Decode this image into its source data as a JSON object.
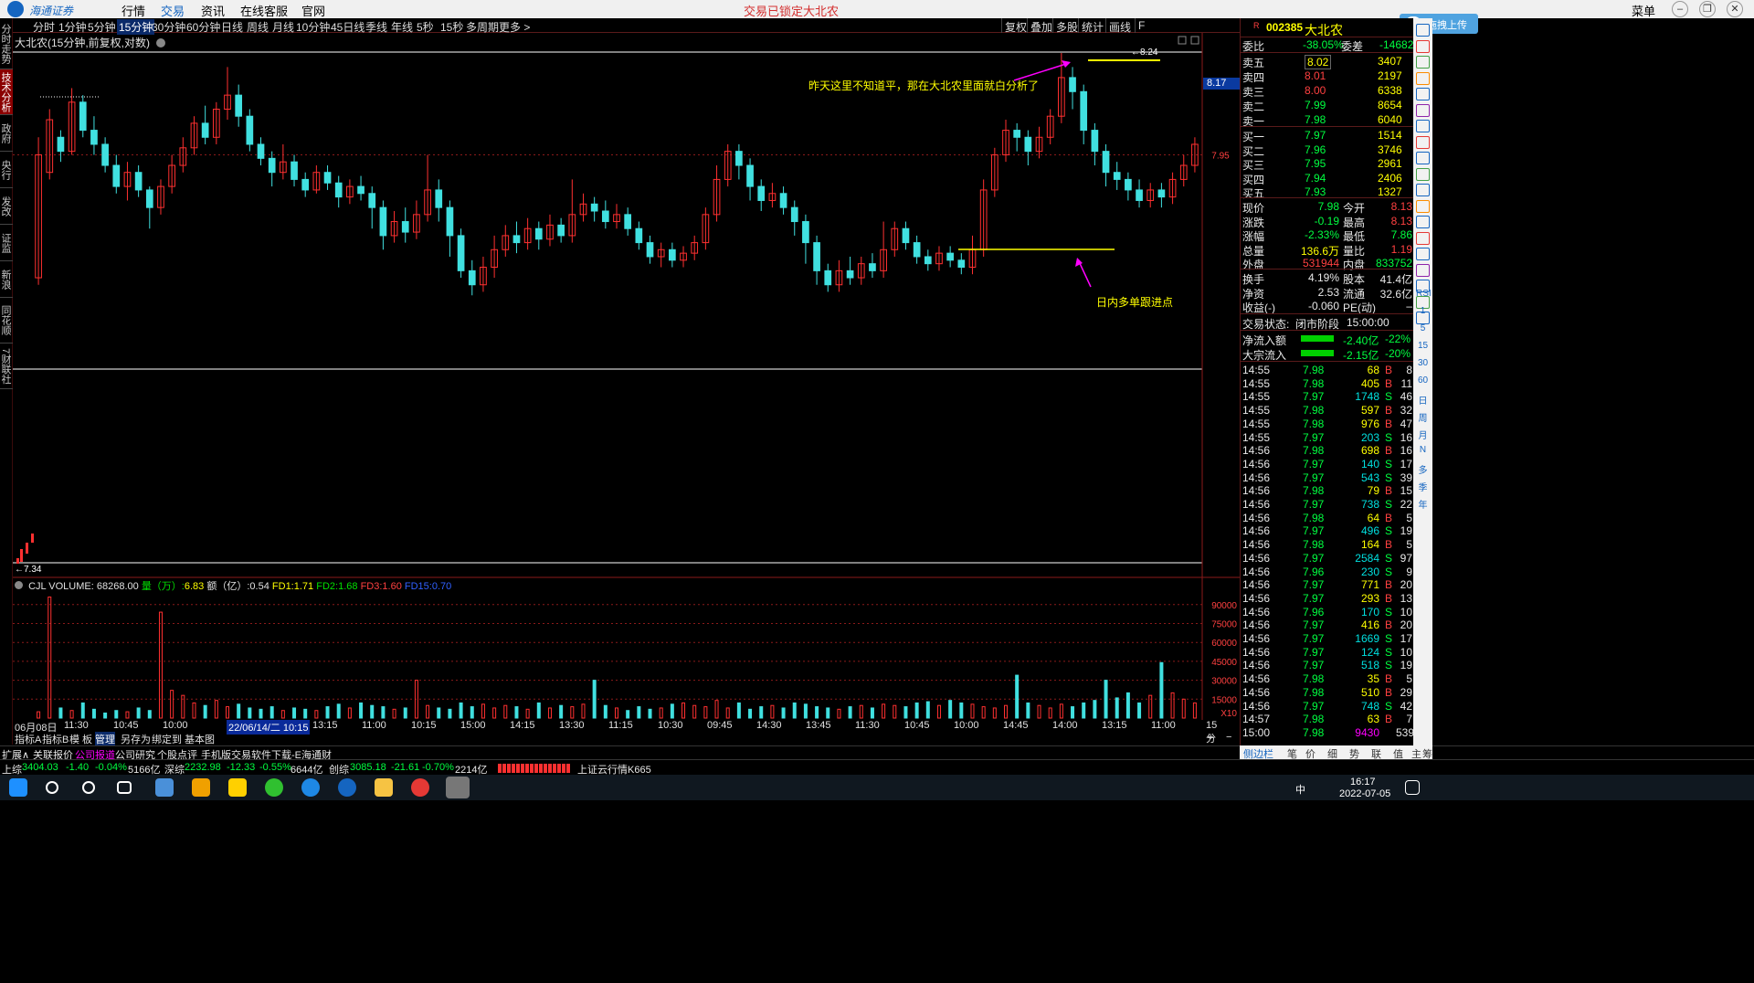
{
  "menu": {
    "logo_text": "海通证券",
    "logo_sub": "HAITONG",
    "items": [
      "行情",
      "交易",
      "资讯",
      "在线客服",
      "官网"
    ],
    "active_index": 1,
    "lock_status": "交易已锁定",
    "stock_tag": "大北农",
    "right_menu": "菜单"
  },
  "left_tabs": [
    "分时走势",
    "技术分析",
    "政府",
    "央行",
    "发改",
    "证监",
    "新浪",
    "同花顺",
    "7财联社"
  ],
  "left_tabs_active": 1,
  "periods": [
    "分时",
    "1分钟",
    "5分钟",
    "15分钟",
    "30分钟",
    "60分钟",
    "日线",
    "周线",
    "月线",
    "10分钟",
    "45日线",
    "季线",
    "年线",
    "5秒",
    "15秒",
    "多周期",
    "更多 >"
  ],
  "period_active": 3,
  "toolbar_right": [
    "复权",
    "叠加",
    "多股",
    "统计",
    "画线",
    "F"
  ],
  "cloud_button": "拖拽上传",
  "chart_title": "大北农(15分钟,前复权,对数)",
  "annotations": {
    "top": "昨天这里不知道平，那在大北农里面就白分析了",
    "mid": "日内多单跟进点"
  },
  "price_labels": {
    "high": "8.24",
    "low": "7.34",
    "axis_label": "7.95",
    "current_box": "8.17"
  },
  "volume_header": {
    "name": "CJL",
    "vol_label": "VOLUME:",
    "vol_value": "68268.00",
    "liang_label": "量（万）:",
    "liang_value": "6.83",
    "e_label": "额（亿）:",
    "e_value": "0.54",
    "fd1_label": "FD1:",
    "fd1_value": "1.71",
    "fd2_label": "FD2:",
    "fd2_value": "1.68",
    "fd3_label": "FD3:",
    "fd3_value": "1.60",
    "fd15_label": "FD15:",
    "fd15_value": "0.70"
  },
  "volume_axis": [
    "90000",
    "75000",
    "60000",
    "45000",
    "30000",
    "15000",
    "X10"
  ],
  "x_axis": [
    "06月08日",
    "11:30",
    "10:45",
    "10:00",
    "14",
    "22/06/14/二 10:15",
    "13:15",
    "11:00",
    "10:15",
    "15:00",
    "14:15",
    "13:30",
    "11:15",
    "10:30",
    "09:45",
    "14:30",
    "13:45",
    "11:30",
    "10:45",
    "10:00",
    "14:45",
    "14:00",
    "13:15",
    "11:00"
  ],
  "x_axis_right": "15分钟",
  "chart_tabs": [
    "指标A",
    "指标B",
    "模 板",
    "管理",
    "另存为",
    "绑定到",
    "基本图"
  ],
  "chart_tabs_active": 3,
  "chart_zoom": [
    "+",
    "−"
  ],
  "status_links": [
    "扩展∧",
    "关联报价",
    "公司报道",
    "公司研究",
    "个股点评",
    "手机版交易软件下载-E海通财"
  ],
  "ticker": {
    "sh_label": "上综",
    "sh_value": "3404.03",
    "sh_chg": "-1.40",
    "sh_pct": "-0.04%",
    "sh_amt": "5166亿",
    "sz_label": "深综",
    "sz_value": "2232.98",
    "sz_chg": "-12.33",
    "sz_pct": "-0.55%",
    "sz_amt": "6644亿",
    "cy_label": "创综",
    "cy_value": "3085.18",
    "cy_chg": "-21.61",
    "cy_pct": "-0.70%",
    "cy_amt": "2214亿",
    "cloud": "上证云行情K665"
  },
  "quote": {
    "code": "002385",
    "name": "大北农",
    "weibi_label": "委比",
    "weibi": "-38.05%",
    "weicha_label": "委差",
    "weicha": "-14682",
    "asks": [
      {
        "label": "卖五",
        "price": "8.02",
        "vol": "3407"
      },
      {
        "label": "卖四",
        "price": "8.01",
        "vol": "2197"
      },
      {
        "label": "卖三",
        "price": "8.00",
        "vol": "6338"
      },
      {
        "label": "卖二",
        "price": "7.99",
        "vol": "8654"
      },
      {
        "label": "卖一",
        "price": "7.98",
        "vol": "6040"
      }
    ],
    "bids": [
      {
        "label": "买一",
        "price": "7.97",
        "vol": "1514"
      },
      {
        "label": "买二",
        "price": "7.96",
        "vol": "3746"
      },
      {
        "label": "买三",
        "price": "7.95",
        "vol": "2961"
      },
      {
        "label": "买四",
        "price": "7.94",
        "vol": "2406"
      },
      {
        "label": "买五",
        "price": "7.93",
        "vol": "1327"
      }
    ],
    "stats": [
      {
        "l1": "现价",
        "v1": "7.98",
        "l2": "今开",
        "v2": "8.13",
        "c1": "green",
        "c2": "red"
      },
      {
        "l1": "涨跌",
        "v1": "-0.19",
        "l2": "最高",
        "v2": "8.13",
        "c1": "green",
        "c2": "red"
      },
      {
        "l1": "涨幅",
        "v1": "-2.33%",
        "l2": "最低",
        "v2": "7.86",
        "c1": "green",
        "c2": "green"
      },
      {
        "l1": "总量",
        "v1": "136.6万",
        "l2": "量比",
        "v2": "1.19",
        "c1": "yellow",
        "c2": "red"
      },
      {
        "l1": "外盘",
        "v1": "531944",
        "l2": "内盘",
        "v2": "833752",
        "c1": "red",
        "c2": "green"
      }
    ],
    "stats2": [
      {
        "l1": "换手",
        "v1": "4.19%",
        "l2": "股本",
        "v2": "41.4亿"
      },
      {
        "l1": "净资",
        "v1": "2.53",
        "l2": "流通",
        "v2": "32.6亿"
      },
      {
        "l1": "收益(-)",
        "v1": "-0.060",
        "l2": "PE(动)",
        "v2": "–"
      }
    ],
    "trade_state_label": "交易状态:",
    "trade_state": "闭市阶段",
    "trade_time": "15:00:00",
    "flows": [
      {
        "label": "净流入额",
        "value": "-2.40亿",
        "pct": "-22%"
      },
      {
        "label": "大宗流入",
        "value": "-2.15亿",
        "pct": "-20%"
      }
    ]
  },
  "ticks": [
    {
      "t": "14:55",
      "p": "7.98",
      "v": "68",
      "d": "B",
      "n": "8"
    },
    {
      "t": "14:55",
      "p": "7.98",
      "v": "405",
      "d": "B",
      "n": "11"
    },
    {
      "t": "14:55",
      "p": "7.97",
      "v": "1748",
      "d": "S",
      "n": "46"
    },
    {
      "t": "14:55",
      "p": "7.98",
      "v": "597",
      "d": "B",
      "n": "32"
    },
    {
      "t": "14:55",
      "p": "7.98",
      "v": "976",
      "d": "B",
      "n": "47"
    },
    {
      "t": "14:55",
      "p": "7.97",
      "v": "203",
      "d": "S",
      "n": "16"
    },
    {
      "t": "14:56",
      "p": "7.98",
      "v": "698",
      "d": "B",
      "n": "16"
    },
    {
      "t": "14:56",
      "p": "7.97",
      "v": "140",
      "d": "S",
      "n": "17"
    },
    {
      "t": "14:56",
      "p": "7.97",
      "v": "543",
      "d": "S",
      "n": "39"
    },
    {
      "t": "14:56",
      "p": "7.98",
      "v": "79",
      "d": "B",
      "n": "15"
    },
    {
      "t": "14:56",
      "p": "7.97",
      "v": "738",
      "d": "S",
      "n": "22"
    },
    {
      "t": "14:56",
      "p": "7.98",
      "v": "64",
      "d": "B",
      "n": "5"
    },
    {
      "t": "14:56",
      "p": "7.97",
      "v": "496",
      "d": "S",
      "n": "19"
    },
    {
      "t": "14:56",
      "p": "7.98",
      "v": "164",
      "d": "B",
      "n": "5"
    },
    {
      "t": "14:56",
      "p": "7.97",
      "v": "2584",
      "d": "S",
      "n": "97"
    },
    {
      "t": "14:56",
      "p": "7.96",
      "v": "230",
      "d": "S",
      "n": "9"
    },
    {
      "t": "14:56",
      "p": "7.97",
      "v": "771",
      "d": "B",
      "n": "20"
    },
    {
      "t": "14:56",
      "p": "7.97",
      "v": "293",
      "d": "B",
      "n": "13"
    },
    {
      "t": "14:56",
      "p": "7.96",
      "v": "170",
      "d": "S",
      "n": "10"
    },
    {
      "t": "14:56",
      "p": "7.97",
      "v": "416",
      "d": "B",
      "n": "20"
    },
    {
      "t": "14:56",
      "p": "7.97",
      "v": "1669",
      "d": "S",
      "n": "17"
    },
    {
      "t": "14:56",
      "p": "7.97",
      "v": "124",
      "d": "S",
      "n": "10"
    },
    {
      "t": "14:56",
      "p": "7.97",
      "v": "518",
      "d": "S",
      "n": "19"
    },
    {
      "t": "14:56",
      "p": "7.98",
      "v": "35",
      "d": "B",
      "n": "5"
    },
    {
      "t": "14:56",
      "p": "7.98",
      "v": "510",
      "d": "B",
      "n": "29"
    },
    {
      "t": "14:56",
      "p": "7.97",
      "v": "748",
      "d": "S",
      "n": "42"
    },
    {
      "t": "14:57",
      "p": "7.98",
      "v": "63",
      "d": "B",
      "n": "7"
    },
    {
      "t": "15:00",
      "p": "7.98",
      "v": "9430",
      "d": "",
      "n": "539"
    }
  ],
  "bottom_tabs": [
    "侧边栏",
    "笔",
    "价",
    "细",
    "势",
    "联",
    "值",
    "主",
    "筹"
  ],
  "sidebar_labels": [
    "RSI",
    "1",
    "5",
    "15",
    "30",
    "60",
    "日",
    "周",
    "月",
    "N",
    "多",
    "季",
    "年"
  ],
  "taskbar": {
    "time": "16:17",
    "date": "2022-07-05",
    "ime": "中"
  },
  "chart_data": {
    "type": "candlestick",
    "period": "15分钟",
    "price_high": 8.24,
    "price_low": 7.34,
    "y_marks": [
      7.95,
      8.17
    ],
    "candles": [
      [
        7.6,
        7.95,
        7.58,
        8.0
      ],
      [
        7.9,
        8.05,
        7.88,
        8.08
      ],
      [
        8.0,
        7.96,
        7.93,
        8.02
      ],
      [
        7.96,
        8.1,
        7.95,
        8.14
      ],
      [
        8.1,
        8.02,
        8.0,
        8.12
      ],
      [
        8.02,
        7.98,
        7.95,
        8.06
      ],
      [
        7.98,
        7.92,
        7.9,
        8.0
      ],
      [
        7.92,
        7.86,
        7.84,
        7.95
      ],
      [
        7.86,
        7.9,
        7.82,
        7.93
      ],
      [
        7.9,
        7.85,
        7.83,
        7.92
      ],
      [
        7.85,
        7.8,
        7.74,
        7.86
      ],
      [
        7.8,
        7.86,
        7.78,
        7.88
      ],
      [
        7.86,
        7.92,
        7.84,
        7.95
      ],
      [
        7.92,
        7.97,
        7.9,
        8.0
      ],
      [
        7.97,
        8.04,
        7.95,
        8.06
      ],
      [
        8.04,
        8.0,
        7.98,
        8.09
      ],
      [
        8.0,
        8.08,
        7.98,
        8.1
      ],
      [
        8.08,
        8.12,
        8.05,
        8.2
      ],
      [
        8.12,
        8.06,
        8.03,
        8.15
      ],
      [
        8.06,
        7.98,
        7.96,
        8.08
      ],
      [
        7.98,
        7.94,
        7.92,
        8.0
      ],
      [
        7.94,
        7.9,
        7.86,
        7.96
      ],
      [
        7.9,
        7.93,
        7.88,
        7.98
      ],
      [
        7.93,
        7.88,
        7.86,
        7.95
      ],
      [
        7.88,
        7.85,
        7.83,
        7.9
      ],
      [
        7.85,
        7.9,
        7.84,
        7.92
      ],
      [
        7.9,
        7.87,
        7.85,
        7.92
      ],
      [
        7.87,
        7.83,
        7.8,
        7.89
      ],
      [
        7.83,
        7.86,
        7.81,
        7.88
      ],
      [
        7.86,
        7.84,
        7.82,
        7.89
      ],
      [
        7.84,
        7.8,
        7.74,
        7.86
      ],
      [
        7.8,
        7.72,
        7.68,
        7.82
      ],
      [
        7.72,
        7.76,
        7.7,
        7.79
      ],
      [
        7.76,
        7.73,
        7.7,
        7.8
      ],
      [
        7.73,
        7.78,
        7.71,
        7.82
      ],
      [
        7.78,
        7.85,
        7.76,
        7.95
      ],
      [
        7.85,
        7.8,
        7.76,
        7.88
      ],
      [
        7.8,
        7.72,
        7.66,
        7.82
      ],
      [
        7.72,
        7.62,
        7.6,
        7.74
      ],
      [
        7.62,
        7.58,
        7.55,
        7.65
      ],
      [
        7.58,
        7.63,
        7.56,
        7.66
      ],
      [
        7.63,
        7.68,
        7.6,
        7.72
      ],
      [
        7.68,
        7.72,
        7.66,
        7.75
      ],
      [
        7.72,
        7.7,
        7.67,
        7.76
      ],
      [
        7.7,
        7.74,
        7.68,
        7.77
      ],
      [
        7.74,
        7.71,
        7.68,
        7.76
      ],
      [
        7.71,
        7.75,
        7.69,
        7.78
      ],
      [
        7.75,
        7.72,
        7.7,
        7.77
      ],
      [
        7.72,
        7.78,
        7.7,
        7.88
      ],
      [
        7.78,
        7.81,
        7.76,
        7.84
      ],
      [
        7.81,
        7.79,
        7.76,
        7.83
      ],
      [
        7.79,
        7.76,
        7.74,
        7.82
      ],
      [
        7.76,
        7.78,
        7.74,
        7.81
      ],
      [
        7.78,
        7.74,
        7.72,
        7.8
      ],
      [
        7.74,
        7.7,
        7.68,
        7.76
      ],
      [
        7.7,
        7.66,
        7.64,
        7.72
      ],
      [
        7.66,
        7.68,
        7.63,
        7.7
      ],
      [
        7.68,
        7.65,
        7.63,
        7.7
      ],
      [
        7.65,
        7.67,
        7.63,
        7.69
      ],
      [
        7.67,
        7.7,
        7.65,
        7.72
      ],
      [
        7.7,
        7.78,
        7.68,
        7.8
      ],
      [
        7.78,
        7.88,
        7.76,
        7.92
      ],
      [
        7.88,
        7.96,
        7.86,
        7.98
      ],
      [
        7.96,
        7.92,
        7.88,
        7.98
      ],
      [
        7.92,
        7.86,
        7.82,
        7.94
      ],
      [
        7.86,
        7.82,
        7.79,
        7.88
      ],
      [
        7.82,
        7.84,
        7.8,
        7.87
      ],
      [
        7.84,
        7.8,
        7.78,
        7.86
      ],
      [
        7.8,
        7.76,
        7.72,
        7.82
      ],
      [
        7.76,
        7.7,
        7.64,
        7.78
      ],
      [
        7.7,
        7.62,
        7.58,
        7.72
      ],
      [
        7.62,
        7.58,
        7.56,
        7.64
      ],
      [
        7.58,
        7.62,
        7.56,
        7.65
      ],
      [
        7.62,
        7.6,
        7.58,
        7.66
      ],
      [
        7.6,
        7.64,
        7.58,
        7.66
      ],
      [
        7.64,
        7.62,
        7.6,
        7.67
      ],
      [
        7.62,
        7.68,
        7.6,
        7.76
      ],
      [
        7.68,
        7.74,
        7.66,
        7.76
      ],
      [
        7.74,
        7.7,
        7.68,
        7.76
      ],
      [
        7.7,
        7.66,
        7.64,
        7.72
      ],
      [
        7.66,
        7.64,
        7.62,
        7.68
      ],
      [
        7.64,
        7.67,
        7.62,
        7.69
      ],
      [
        7.67,
        7.65,
        7.63,
        7.69
      ],
      [
        7.65,
        7.63,
        7.61,
        7.67
      ],
      [
        7.63,
        7.68,
        7.61,
        7.72
      ],
      [
        7.68,
        7.85,
        7.66,
        7.88
      ],
      [
        7.85,
        7.95,
        7.83,
        7.97
      ],
      [
        7.95,
        8.02,
        7.93,
        8.05
      ],
      [
        8.02,
        8.0,
        7.96,
        8.04
      ],
      [
        8.0,
        7.96,
        7.92,
        8.02
      ],
      [
        7.96,
        8.0,
        7.94,
        8.03
      ],
      [
        8.0,
        8.06,
        7.98,
        8.08
      ],
      [
        8.06,
        8.17,
        8.04,
        8.24
      ],
      [
        8.17,
        8.13,
        8.08,
        8.2
      ],
      [
        8.13,
        8.02,
        7.98,
        8.15
      ],
      [
        8.02,
        7.96,
        7.92,
        8.04
      ],
      [
        7.96,
        7.9,
        7.86,
        7.98
      ],
      [
        7.9,
        7.88,
        7.85,
        7.93
      ],
      [
        7.88,
        7.85,
        7.82,
        7.9
      ],
      [
        7.85,
        7.82,
        7.8,
        7.88
      ],
      [
        7.82,
        7.85,
        7.8,
        7.87
      ],
      [
        7.85,
        7.83,
        7.8,
        7.87
      ],
      [
        7.83,
        7.88,
        7.81,
        7.9
      ],
      [
        7.88,
        7.92,
        7.86,
        7.95
      ],
      [
        7.92,
        7.98,
        7.9,
        8.0
      ]
    ],
    "volumes": [
      5000,
      96000,
      8000,
      6000,
      12000,
      7000,
      4000,
      6000,
      5000,
      8000,
      6000,
      84000,
      22000,
      18000,
      12000,
      10000,
      14000,
      9000,
      11000,
      8000,
      7000,
      9000,
      6000,
      8000,
      7000,
      6000,
      9000,
      11000,
      8000,
      12000,
      10000,
      9000,
      7000,
      8000,
      30000,
      10000,
      8000,
      7000,
      12000,
      9000,
      11000,
      8000,
      10000,
      9000,
      7000,
      12000,
      8000,
      10000,
      9000,
      11000,
      30000,
      10000,
      8000,
      6000,
      9000,
      7000,
      8000,
      11000,
      12000,
      10000,
      9000,
      14000,
      8000,
      12000,
      7000,
      9000,
      10000,
      8000,
      12000,
      11000,
      9000,
      8000,
      7000,
      9000,
      10000,
      8000,
      11000,
      10000,
      9000,
      12000,
      13000,
      10000,
      14000,
      12000,
      11000,
      9000,
      8000,
      10000,
      34000,
      12000,
      10000,
      8000,
      11000,
      9000,
      12000,
      14000,
      30000,
      16000,
      20000,
      12000,
      18000,
      44000,
      20000,
      15000,
      12000
    ]
  }
}
